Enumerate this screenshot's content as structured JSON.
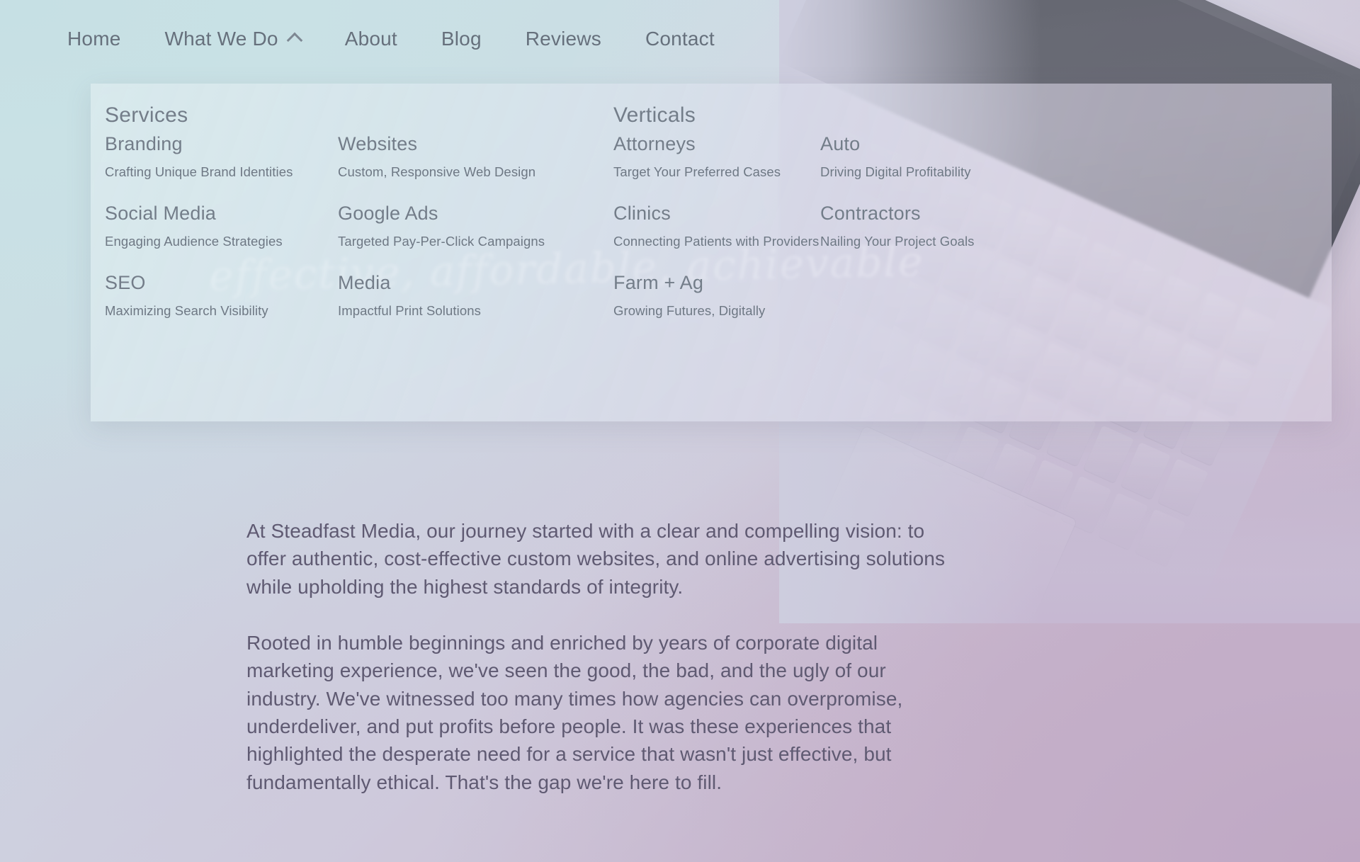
{
  "nav": {
    "items": [
      {
        "label": "Home"
      },
      {
        "label": "What We Do",
        "icon": "chevron-up-icon",
        "expanded": true
      },
      {
        "label": "About"
      },
      {
        "label": "Blog"
      },
      {
        "label": "Reviews"
      },
      {
        "label": "Contact"
      }
    ]
  },
  "megamenu": {
    "headings": {
      "services": "Services",
      "verticals": "Verticals"
    },
    "services_col1": [
      {
        "title": "Branding",
        "subtitle": "Crafting Unique Brand Identities"
      },
      {
        "title": "Social Media",
        "subtitle": "Engaging Audience Strategies"
      },
      {
        "title": "SEO",
        "subtitle": "Maximizing Search Visibility"
      }
    ],
    "services_col2": [
      {
        "title": "Websites",
        "subtitle": "Custom, Responsive Web Design"
      },
      {
        "title": "Google Ads",
        "subtitle": "Targeted Pay-Per-Click Campaigns"
      },
      {
        "title": "Media",
        "subtitle": "Impactful Print Solutions"
      }
    ],
    "verticals_col1": [
      {
        "title": "Attorneys",
        "subtitle": "Target Your Preferred Cases"
      },
      {
        "title": "Clinics",
        "subtitle": "Connecting Patients with Providers"
      },
      {
        "title": "Farm + Ag",
        "subtitle": "Growing Futures, Digitally"
      }
    ],
    "verticals_col2": [
      {
        "title": "Auto",
        "subtitle": "Driving Digital Profitability"
      },
      {
        "title": "Contractors",
        "subtitle": "Nailing Your Project Goals"
      }
    ]
  },
  "watermark": {
    "text": "effective, affordable, achievable"
  },
  "body": {
    "paragraph_1": "At Steadfast Media, our journey started with a clear and compelling vision: to offer authentic, cost-effective custom websites, and online advertising solutions while upholding the highest standards of integrity.",
    "paragraph_2": "Rooted in humble beginnings and enriched by years of corporate digital marketing experience, we've seen the good, the bad, and the ugly of our industry. We've witnessed too many times how agencies can overpromise, underdeliver, and put profits before people. It was these experiences that highlighted the desperate need for a service that wasn't just effective, but fundamentally ethical. That's the gap we're here to fill."
  },
  "colors": {
    "nav_text": "#66707c",
    "menu_title": "#737d89",
    "menu_subtitle": "#6e7884",
    "body_text": "#5f5a72",
    "bg_start": "#c8e0e5",
    "bg_end": "#bda5c2",
    "panel": "#dceaee"
  }
}
